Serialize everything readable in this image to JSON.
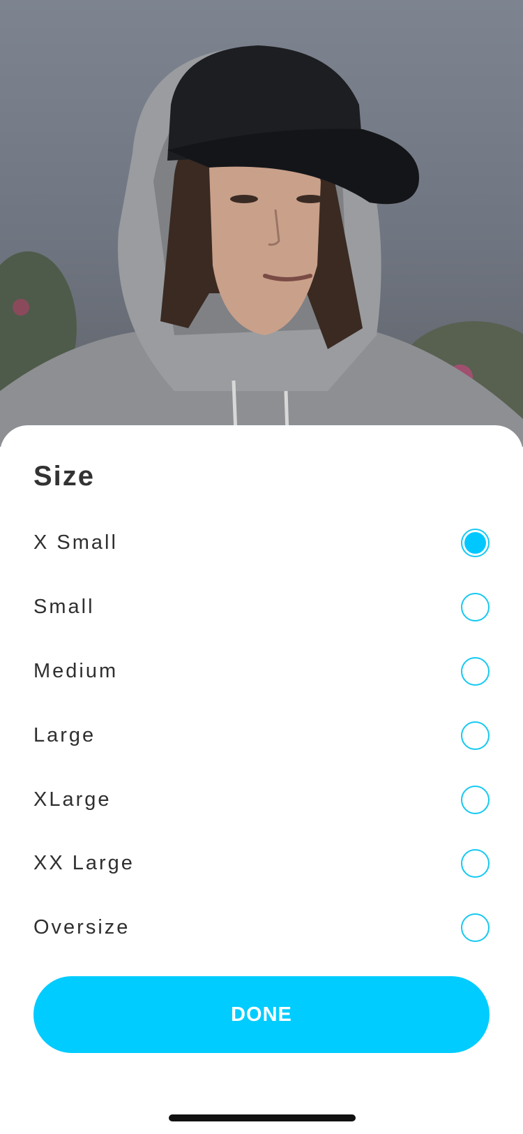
{
  "sheet": {
    "title": "Size",
    "options": [
      {
        "label": "X Small",
        "selected": true
      },
      {
        "label": "Small",
        "selected": false
      },
      {
        "label": "Medium",
        "selected": false
      },
      {
        "label": "Large",
        "selected": false
      },
      {
        "label": "XLarge",
        "selected": false
      },
      {
        "label": "XX Large",
        "selected": false
      },
      {
        "label": "Oversize",
        "selected": false
      }
    ],
    "done_label": "DONE"
  },
  "colors": {
    "accent": "#00ccff",
    "text": "#333333"
  }
}
